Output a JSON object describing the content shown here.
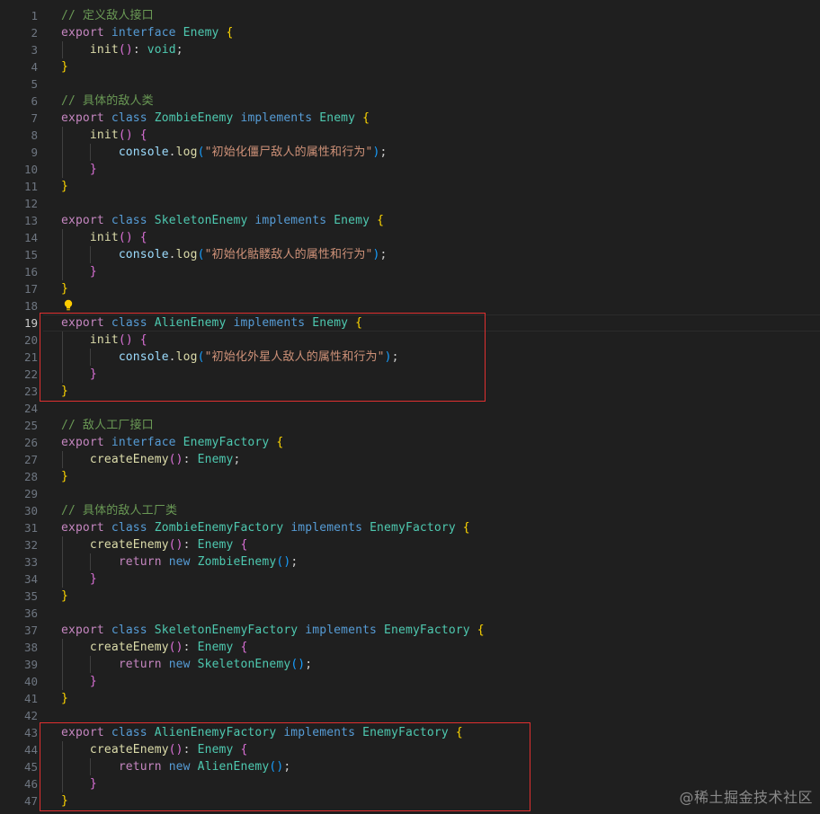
{
  "editor": {
    "language": "typescript",
    "active_line": "19",
    "lines": [
      {
        "n": "1",
        "tokens": [
          [
            "// 定义敌人接口",
            "comment"
          ]
        ]
      },
      {
        "n": "2",
        "tokens": [
          [
            "export",
            "kw2"
          ],
          [
            " ",
            "punc"
          ],
          [
            "interface",
            "kw"
          ],
          [
            " ",
            "punc"
          ],
          [
            "Enemy",
            "type"
          ],
          [
            " ",
            "punc"
          ],
          [
            "{",
            "b1"
          ]
        ]
      },
      {
        "n": "3",
        "tokens": [
          [
            "    ",
            "punc"
          ],
          [
            "init",
            "fn"
          ],
          [
            "()",
            "b2"
          ],
          [
            ": ",
            "punc"
          ],
          [
            "void",
            "type"
          ],
          [
            ";",
            "punc"
          ]
        ]
      },
      {
        "n": "4",
        "tokens": [
          [
            "}",
            "b1"
          ]
        ]
      },
      {
        "n": "5",
        "tokens": []
      },
      {
        "n": "6",
        "tokens": [
          [
            "// 具体的敌人类",
            "comment"
          ]
        ]
      },
      {
        "n": "7",
        "tokens": [
          [
            "export",
            "kw2"
          ],
          [
            " ",
            "punc"
          ],
          [
            "class",
            "kw"
          ],
          [
            " ",
            "punc"
          ],
          [
            "ZombieEnemy",
            "type"
          ],
          [
            " ",
            "punc"
          ],
          [
            "implements",
            "kw"
          ],
          [
            " ",
            "punc"
          ],
          [
            "Enemy",
            "type"
          ],
          [
            " ",
            "punc"
          ],
          [
            "{",
            "b1"
          ]
        ]
      },
      {
        "n": "8",
        "tokens": [
          [
            "    ",
            "punc"
          ],
          [
            "init",
            "fn"
          ],
          [
            "()",
            "b2"
          ],
          [
            " ",
            "punc"
          ],
          [
            "{",
            "b2"
          ]
        ]
      },
      {
        "n": "9",
        "tokens": [
          [
            "        ",
            "punc"
          ],
          [
            "console",
            "var"
          ],
          [
            ".",
            "punc"
          ],
          [
            "log",
            "fn"
          ],
          [
            "(",
            "b3"
          ],
          [
            "\"初始化僵尸敌人的属性和行为\"",
            "str"
          ],
          [
            ")",
            "b3"
          ],
          [
            ";",
            "punc"
          ]
        ]
      },
      {
        "n": "10",
        "tokens": [
          [
            "    ",
            "punc"
          ],
          [
            "}",
            "b2"
          ]
        ]
      },
      {
        "n": "11",
        "tokens": [
          [
            "}",
            "b1"
          ]
        ]
      },
      {
        "n": "12",
        "tokens": []
      },
      {
        "n": "13",
        "tokens": [
          [
            "export",
            "kw2"
          ],
          [
            " ",
            "punc"
          ],
          [
            "class",
            "kw"
          ],
          [
            " ",
            "punc"
          ],
          [
            "SkeletonEnemy",
            "type"
          ],
          [
            " ",
            "punc"
          ],
          [
            "implements",
            "kw"
          ],
          [
            " ",
            "punc"
          ],
          [
            "Enemy",
            "type"
          ],
          [
            " ",
            "punc"
          ],
          [
            "{",
            "b1"
          ]
        ]
      },
      {
        "n": "14",
        "tokens": [
          [
            "    ",
            "punc"
          ],
          [
            "init",
            "fn"
          ],
          [
            "()",
            "b2"
          ],
          [
            " ",
            "punc"
          ],
          [
            "{",
            "b2"
          ]
        ]
      },
      {
        "n": "15",
        "tokens": [
          [
            "        ",
            "punc"
          ],
          [
            "console",
            "var"
          ],
          [
            ".",
            "punc"
          ],
          [
            "log",
            "fn"
          ],
          [
            "(",
            "b3"
          ],
          [
            "\"初始化骷髅敌人的属性和行为\"",
            "str"
          ],
          [
            ")",
            "b3"
          ],
          [
            ";",
            "punc"
          ]
        ]
      },
      {
        "n": "16",
        "tokens": [
          [
            "    ",
            "punc"
          ],
          [
            "}",
            "b2"
          ]
        ]
      },
      {
        "n": "17",
        "tokens": [
          [
            "}",
            "b1"
          ]
        ]
      },
      {
        "n": "18",
        "tokens": []
      },
      {
        "n": "19",
        "tokens": [
          [
            "export",
            "kw2"
          ],
          [
            " ",
            "punc"
          ],
          [
            "class",
            "kw"
          ],
          [
            " ",
            "punc"
          ],
          [
            "AlienEnemy",
            "type"
          ],
          [
            " ",
            "punc"
          ],
          [
            "implements",
            "kw"
          ],
          [
            " ",
            "punc"
          ],
          [
            "Enemy",
            "type"
          ],
          [
            " ",
            "punc"
          ],
          [
            "{",
            "b1"
          ]
        ]
      },
      {
        "n": "20",
        "tokens": [
          [
            "    ",
            "punc"
          ],
          [
            "init",
            "fn"
          ],
          [
            "()",
            "b2"
          ],
          [
            " ",
            "punc"
          ],
          [
            "{",
            "b2"
          ]
        ]
      },
      {
        "n": "21",
        "tokens": [
          [
            "        ",
            "punc"
          ],
          [
            "console",
            "var"
          ],
          [
            ".",
            "punc"
          ],
          [
            "log",
            "fn"
          ],
          [
            "(",
            "b3"
          ],
          [
            "\"初始化外星人敌人的属性和行为\"",
            "str"
          ],
          [
            ")",
            "b3"
          ],
          [
            ";",
            "punc"
          ]
        ]
      },
      {
        "n": "22",
        "tokens": [
          [
            "    ",
            "punc"
          ],
          [
            "}",
            "b2"
          ]
        ]
      },
      {
        "n": "23",
        "tokens": [
          [
            "}",
            "b1"
          ]
        ]
      },
      {
        "n": "24",
        "tokens": []
      },
      {
        "n": "25",
        "tokens": [
          [
            "// 敌人工厂接口",
            "comment"
          ]
        ]
      },
      {
        "n": "26",
        "tokens": [
          [
            "export",
            "kw2"
          ],
          [
            " ",
            "punc"
          ],
          [
            "interface",
            "kw"
          ],
          [
            " ",
            "punc"
          ],
          [
            "EnemyFactory",
            "type"
          ],
          [
            " ",
            "punc"
          ],
          [
            "{",
            "b1"
          ]
        ]
      },
      {
        "n": "27",
        "tokens": [
          [
            "    ",
            "punc"
          ],
          [
            "createEnemy",
            "fn"
          ],
          [
            "()",
            "b2"
          ],
          [
            ": ",
            "punc"
          ],
          [
            "Enemy",
            "type"
          ],
          [
            ";",
            "punc"
          ]
        ]
      },
      {
        "n": "28",
        "tokens": [
          [
            "}",
            "b1"
          ]
        ]
      },
      {
        "n": "29",
        "tokens": []
      },
      {
        "n": "30",
        "tokens": [
          [
            "// 具体的敌人工厂类",
            "comment"
          ]
        ]
      },
      {
        "n": "31",
        "tokens": [
          [
            "export",
            "kw2"
          ],
          [
            " ",
            "punc"
          ],
          [
            "class",
            "kw"
          ],
          [
            " ",
            "punc"
          ],
          [
            "ZombieEnemyFactory",
            "type"
          ],
          [
            " ",
            "punc"
          ],
          [
            "implements",
            "kw"
          ],
          [
            " ",
            "punc"
          ],
          [
            "EnemyFactory",
            "type"
          ],
          [
            " ",
            "punc"
          ],
          [
            "{",
            "b1"
          ]
        ]
      },
      {
        "n": "32",
        "tokens": [
          [
            "    ",
            "punc"
          ],
          [
            "createEnemy",
            "fn"
          ],
          [
            "()",
            "b2"
          ],
          [
            ": ",
            "punc"
          ],
          [
            "Enemy",
            "type"
          ],
          [
            " ",
            "punc"
          ],
          [
            "{",
            "b2"
          ]
        ]
      },
      {
        "n": "33",
        "tokens": [
          [
            "        ",
            "punc"
          ],
          [
            "return",
            "kw2"
          ],
          [
            " ",
            "punc"
          ],
          [
            "new",
            "kw"
          ],
          [
            " ",
            "punc"
          ],
          [
            "ZombieEnemy",
            "type"
          ],
          [
            "()",
            "b3"
          ],
          [
            ";",
            "punc"
          ]
        ]
      },
      {
        "n": "34",
        "tokens": [
          [
            "    ",
            "punc"
          ],
          [
            "}",
            "b2"
          ]
        ]
      },
      {
        "n": "35",
        "tokens": [
          [
            "}",
            "b1"
          ]
        ]
      },
      {
        "n": "36",
        "tokens": []
      },
      {
        "n": "37",
        "tokens": [
          [
            "export",
            "kw2"
          ],
          [
            " ",
            "punc"
          ],
          [
            "class",
            "kw"
          ],
          [
            " ",
            "punc"
          ],
          [
            "SkeletonEnemyFactory",
            "type"
          ],
          [
            " ",
            "punc"
          ],
          [
            "implements",
            "kw"
          ],
          [
            " ",
            "punc"
          ],
          [
            "EnemyFactory",
            "type"
          ],
          [
            " ",
            "punc"
          ],
          [
            "{",
            "b1"
          ]
        ]
      },
      {
        "n": "38",
        "tokens": [
          [
            "    ",
            "punc"
          ],
          [
            "createEnemy",
            "fn"
          ],
          [
            "()",
            "b2"
          ],
          [
            ": ",
            "punc"
          ],
          [
            "Enemy",
            "type"
          ],
          [
            " ",
            "punc"
          ],
          [
            "{",
            "b2"
          ]
        ]
      },
      {
        "n": "39",
        "tokens": [
          [
            "        ",
            "punc"
          ],
          [
            "return",
            "kw2"
          ],
          [
            " ",
            "punc"
          ],
          [
            "new",
            "kw"
          ],
          [
            " ",
            "punc"
          ],
          [
            "SkeletonEnemy",
            "type"
          ],
          [
            "()",
            "b3"
          ],
          [
            ";",
            "punc"
          ]
        ]
      },
      {
        "n": "40",
        "tokens": [
          [
            "    ",
            "punc"
          ],
          [
            "}",
            "b2"
          ]
        ]
      },
      {
        "n": "41",
        "tokens": [
          [
            "}",
            "b1"
          ]
        ]
      },
      {
        "n": "42",
        "tokens": []
      },
      {
        "n": "43",
        "tokens": [
          [
            "export",
            "kw2"
          ],
          [
            " ",
            "punc"
          ],
          [
            "class",
            "kw"
          ],
          [
            " ",
            "punc"
          ],
          [
            "AlienEnemyFactory",
            "type"
          ],
          [
            " ",
            "punc"
          ],
          [
            "implements",
            "kw"
          ],
          [
            " ",
            "punc"
          ],
          [
            "EnemyFactory",
            "type"
          ],
          [
            " ",
            "punc"
          ],
          [
            "{",
            "b1"
          ]
        ]
      },
      {
        "n": "44",
        "tokens": [
          [
            "    ",
            "punc"
          ],
          [
            "createEnemy",
            "fn"
          ],
          [
            "()",
            "b2"
          ],
          [
            ": ",
            "punc"
          ],
          [
            "Enemy",
            "type"
          ],
          [
            " ",
            "punc"
          ],
          [
            "{",
            "b2"
          ]
        ]
      },
      {
        "n": "45",
        "tokens": [
          [
            "        ",
            "punc"
          ],
          [
            "return",
            "kw2"
          ],
          [
            " ",
            "punc"
          ],
          [
            "new",
            "kw"
          ],
          [
            " ",
            "punc"
          ],
          [
            "AlienEnemy",
            "type"
          ],
          [
            "()",
            "b3"
          ],
          [
            ";",
            "punc"
          ]
        ]
      },
      {
        "n": "46",
        "tokens": [
          [
            "    ",
            "punc"
          ],
          [
            "}",
            "b2"
          ]
        ]
      },
      {
        "n": "47",
        "tokens": [
          [
            "}",
            "b1"
          ]
        ]
      }
    ]
  },
  "highlights": [
    {
      "label": "alien-enemy-class",
      "from_line": "19",
      "to_line": "23"
    },
    {
      "label": "alien-enemy-factory-class",
      "from_line": "43",
      "to_line": "47"
    }
  ],
  "lightbulb": {
    "icon": "lightbulb-icon",
    "line": "18",
    "color": "#ffcc00"
  },
  "watermark": {
    "text": "@稀土掘金技术社区"
  },
  "colors": {
    "background": "#1f1f1f",
    "highlight_border": "#e03030",
    "comment": "#6a9955",
    "keyword": "#569cd6",
    "control_keyword": "#c586c0",
    "type": "#4ec9b0",
    "function": "#dcdcaa",
    "variable": "#9cdcfe",
    "string": "#ce9178"
  }
}
